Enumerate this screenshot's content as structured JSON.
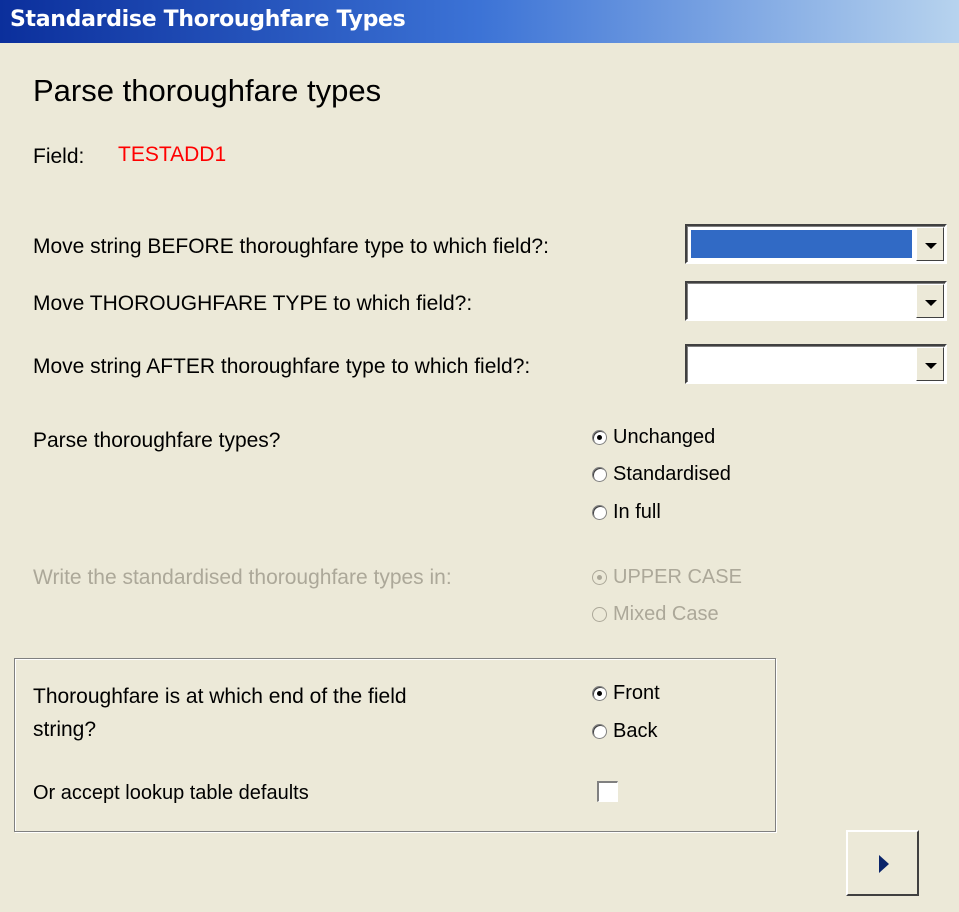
{
  "window": {
    "title": "Standardise Thoroughfare Types"
  },
  "heading": "Parse thoroughfare types",
  "field": {
    "label": "Field:",
    "value": "TESTADD1"
  },
  "combos": [
    {
      "label": "Move string BEFORE thoroughfare type to which field?:",
      "value": ""
    },
    {
      "label": "Move THOROUGHFARE TYPE to which field?:",
      "value": ""
    },
    {
      "label": "Move string AFTER thoroughfare type to which field?:",
      "value": ""
    }
  ],
  "parse": {
    "question": "Parse thoroughfare types?",
    "options": [
      "Unchanged",
      "Standardised",
      "In full"
    ],
    "selected": "Unchanged"
  },
  "case": {
    "question": "Write the standardised thoroughfare types in:",
    "options": [
      "UPPER CASE",
      "Mixed Case"
    ],
    "selected": "UPPER CASE",
    "enabled": false
  },
  "end": {
    "question": "Thoroughfare is at which end of the field string?",
    "question_line1": "Thoroughfare is at which end of the field",
    "question_line2": "string?",
    "options": [
      "Front",
      "Back"
    ],
    "selected": "Front"
  },
  "lookup": {
    "label": "Or accept lookup table defaults",
    "checked": false
  },
  "next_button": {
    "icon": "play-right-icon"
  },
  "colors": {
    "title_bar": "#3c73d6",
    "selection": "#316ac5",
    "field_value": "#ff0000",
    "background": "#ece9d8"
  }
}
